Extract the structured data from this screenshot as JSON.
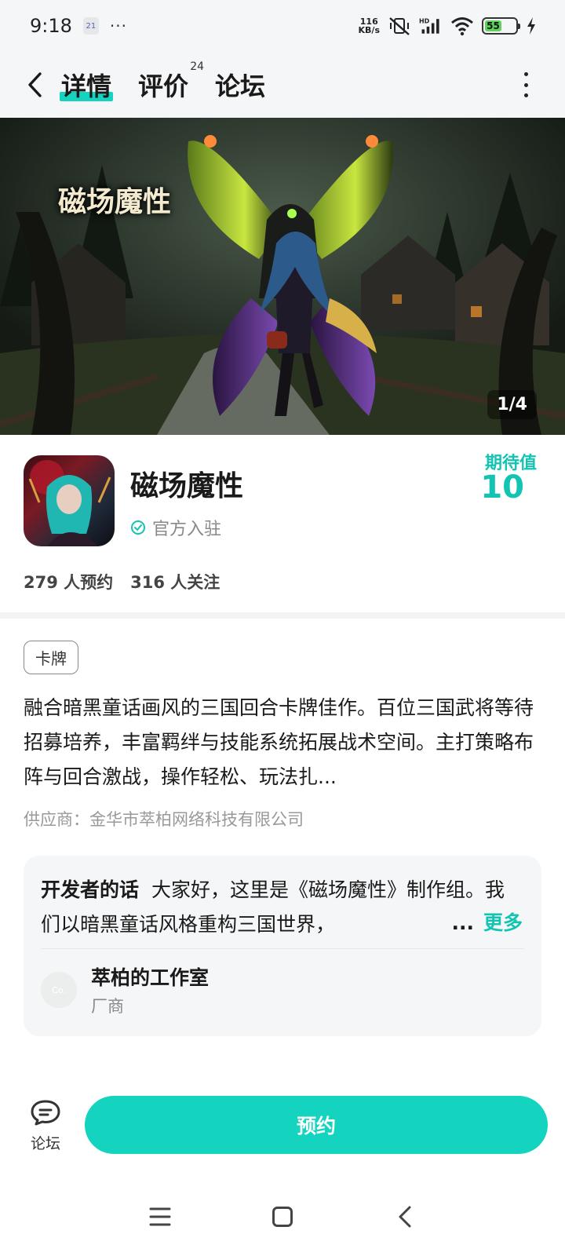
{
  "status_bar": {
    "time": "9:18",
    "calendar_badge": "21",
    "more_dots": "···",
    "net_speed_value": "116",
    "net_speed_unit": "KB/s",
    "battery": "55",
    "icons": [
      "calendar-icon",
      "mute-vibrate-icon",
      "hd-signal-icon",
      "wifi-icon",
      "battery-icon",
      "charging-icon"
    ]
  },
  "header": {
    "tabs": [
      {
        "label": "详情",
        "active": true
      },
      {
        "label": "评价",
        "badge": "24"
      },
      {
        "label": "论坛"
      }
    ]
  },
  "banner": {
    "title": "磁场魔性",
    "page_indicator": "1/4"
  },
  "game": {
    "name": "磁场魔性",
    "verified_label": "官方入驻",
    "expect_label": "期待值",
    "expect_value": "10",
    "reservations": "279 人预约",
    "followers": "316 人关注"
  },
  "details": {
    "tag": "卡牌",
    "description": "融合暗黑童话画风的三国回合卡牌佳作。百位三国武将等待招募培养，丰富羁绊与技能系统拓展战术空间。主打策略布阵与回合激战，操作轻松、玩法扎...",
    "supplier": "供应商：金华市萃柏网络科技有限公司"
  },
  "developer": {
    "label": "开发者的话",
    "text": "大家好，这里是《磁场魔性》制作组。我们以暗黑童话风格重构三国世界，",
    "ellipsis": "...",
    "more_label": "更多",
    "studio_avatar_text": "Co.",
    "studio_name": "萃柏的工作室",
    "studio_role": "厂商"
  },
  "action_bar": {
    "forum_label": "论坛",
    "reserve_label": "预约"
  },
  "colors": {
    "accent": "#14d4c0",
    "accent_text": "#14c4b2"
  }
}
